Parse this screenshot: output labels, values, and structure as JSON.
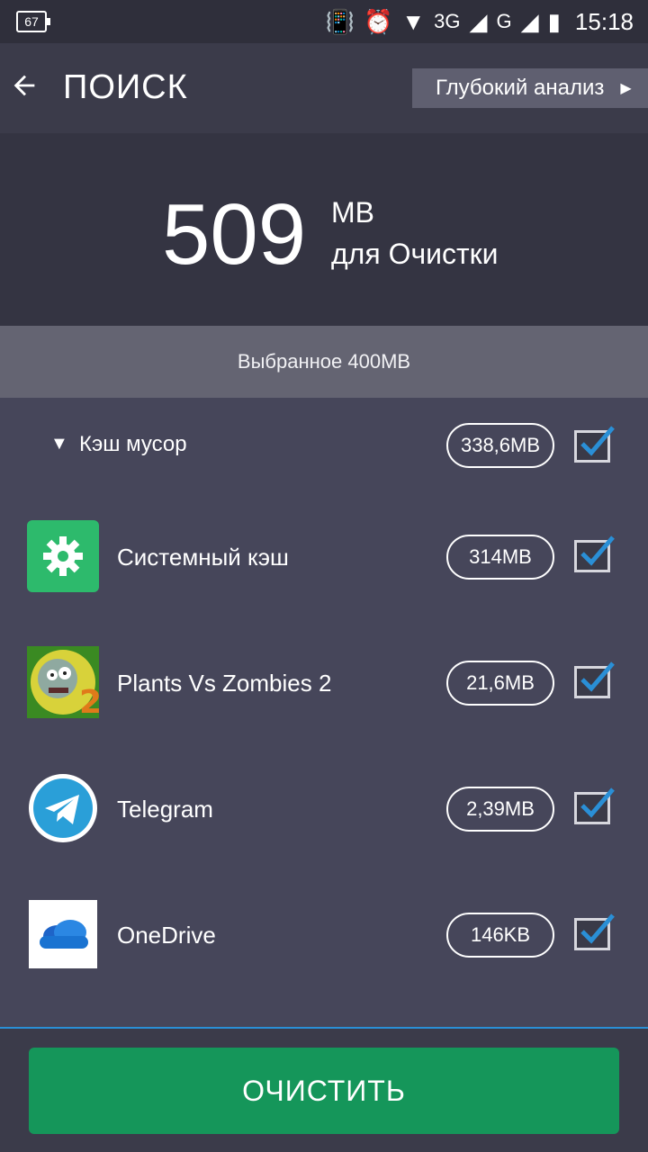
{
  "status_bar": {
    "battery": "67",
    "network_3g": "3G",
    "network_g": "G",
    "time": "15:18"
  },
  "header": {
    "title": "ПОИСК",
    "deep_scan": "Глубокий анализ"
  },
  "summary": {
    "amount": "509",
    "unit": "MB",
    "caption": "для Очистки"
  },
  "selected_label": "Выбранное 400MB",
  "group": {
    "label": "Кэш мусор",
    "size": "338,6MB",
    "checked": true
  },
  "items": [
    {
      "name": "Системный кэш",
      "size": "314MB",
      "icon": "settings-gear-icon",
      "checked": true
    },
    {
      "name": "Plants Vs Zombies 2",
      "size": "21,6MB",
      "icon": "plants-vs-zombies-icon",
      "checked": true
    },
    {
      "name": "Telegram",
      "size": "2,39MB",
      "icon": "telegram-icon",
      "checked": true
    },
    {
      "name": "OneDrive",
      "size": "146KB",
      "icon": "onedrive-icon",
      "checked": true
    }
  ],
  "actions": {
    "clean": "ОЧИСТИТЬ"
  },
  "colors": {
    "background": "#46465a",
    "accent_green": "#15965a",
    "checkbox_check": "#2a8fd6"
  }
}
